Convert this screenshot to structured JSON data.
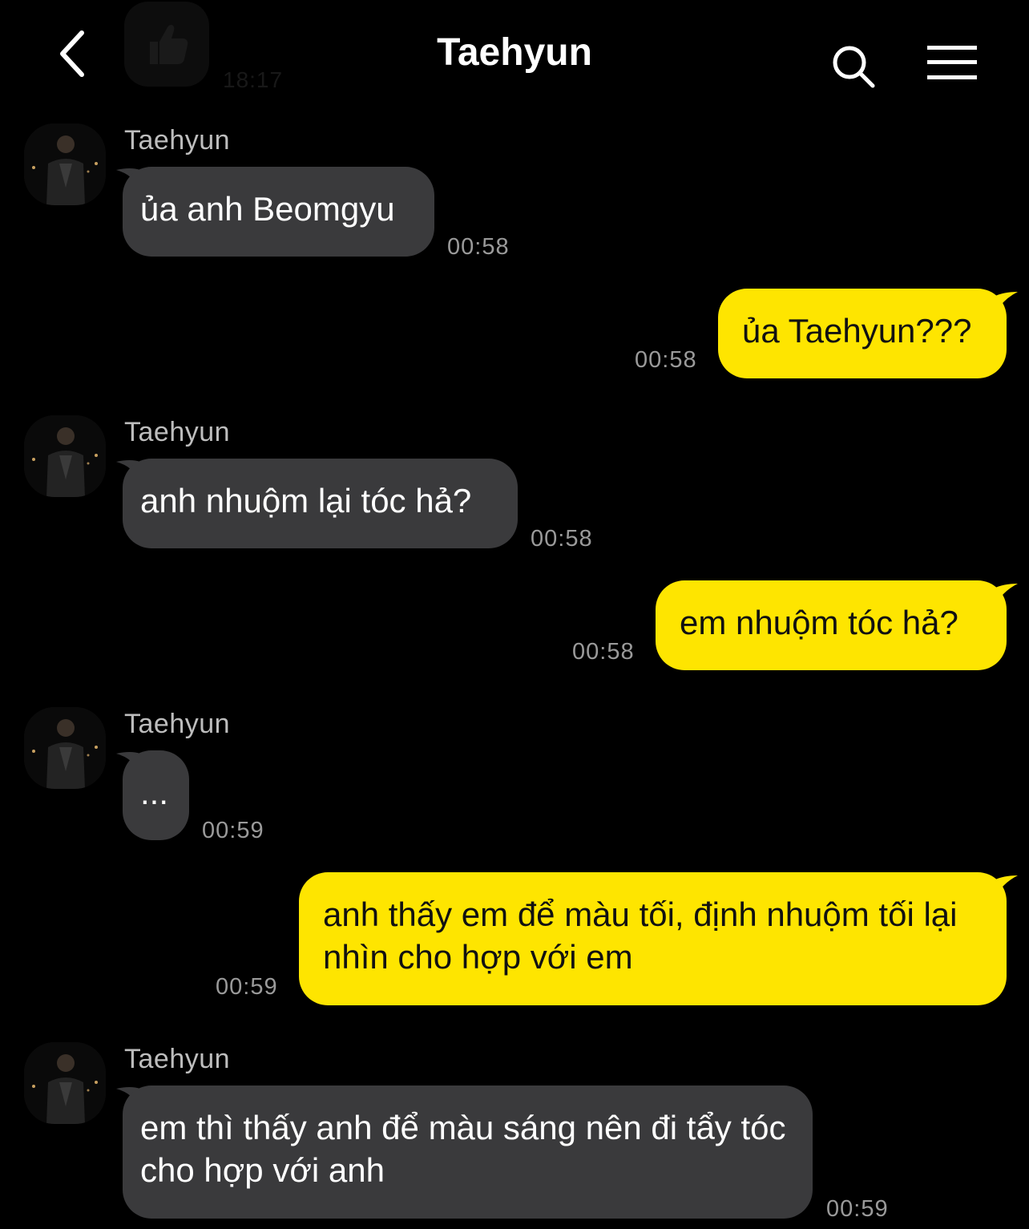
{
  "header": {
    "title": "Taehyun",
    "previous_time": "18:17",
    "icons": {
      "back": "chevron-left-icon",
      "search": "search-icon",
      "menu": "hamburger-menu-icon",
      "previous": "thumbs-up-emoticon"
    }
  },
  "colors": {
    "background": "#000000",
    "incoming_bubble": "#3a3a3c",
    "outgoing_bubble": "#fee500",
    "timestamp": "#9a9a9a"
  },
  "messages": [
    {
      "direction": "in",
      "sender": "Taehyun",
      "text": "ủa anh Beomgyu",
      "time": "00:58"
    },
    {
      "direction": "out",
      "text": "ủa Taehyun???",
      "time": "00:58"
    },
    {
      "direction": "in",
      "sender": "Taehyun",
      "text": "anh nhuộm lại tóc hả?",
      "time": "00:58"
    },
    {
      "direction": "out",
      "text": "em nhuộm tóc hả?",
      "time": "00:58"
    },
    {
      "direction": "in",
      "sender": "Taehyun",
      "text": "...",
      "time": "00:59"
    },
    {
      "direction": "out",
      "text": "anh thấy em để màu tối, định nhuộm tối lại nhìn cho hợp với em",
      "time": "00:59"
    },
    {
      "direction": "in",
      "sender": "Taehyun",
      "text": "em thì thấy anh để màu sáng nên đi tẩy tóc cho hợp với anh",
      "time": "00:59"
    }
  ]
}
